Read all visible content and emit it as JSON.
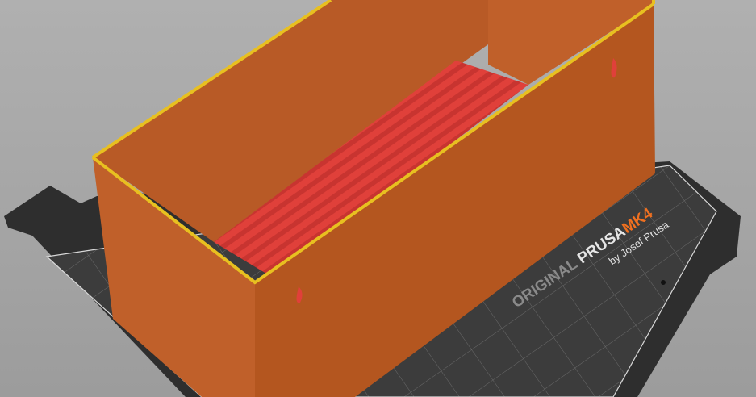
{
  "viewport": {
    "bed_logo": {
      "original": "ORIGINAL",
      "prusa": "PRUSA",
      "model": "MK4",
      "byline": "by Josef Prusa"
    },
    "colors": {
      "background": "#a9a9a9",
      "bed": "#2e2e2e",
      "bed_grid_area": "#3c3c3c",
      "model_wall": "#c0602a",
      "model_wall_dark": "#a85222",
      "infill": "#e0403a",
      "perimeter_edge": "#e8c020",
      "logo_accent": "#f07020"
    }
  }
}
